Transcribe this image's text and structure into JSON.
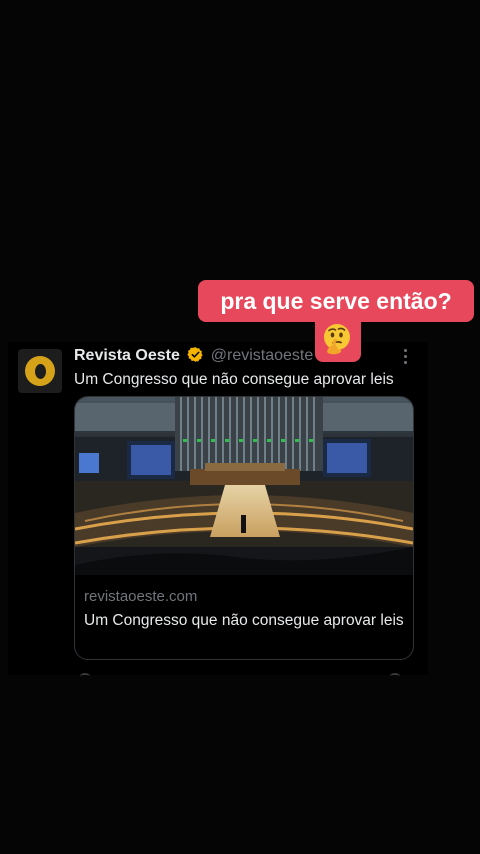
{
  "caption": {
    "text": "pra que serve então?",
    "emoji_icon": "thinking-face-icon",
    "color": "#e8485c"
  },
  "tweet": {
    "author": "Revista Oeste",
    "handle": "@revistaoeste",
    "verified_icon": "verified-badge-icon",
    "verified_color": "#f4b400",
    "text": "Um Congresso que não consegue aprovar leis",
    "link_card": {
      "image_icon": "congress-chamber-photo",
      "domain": "revistaoeste.com",
      "title": "Um Congresso que não consegue aprovar leis"
    }
  }
}
